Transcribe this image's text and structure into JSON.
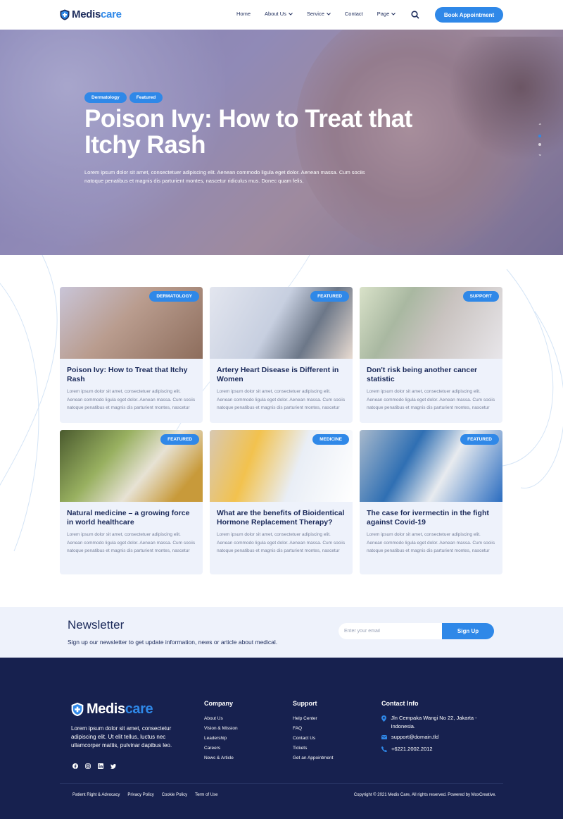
{
  "header": {
    "brand_part1": "Medis",
    "brand_part2": "care",
    "nav": [
      {
        "label": "Home",
        "dropdown": false
      },
      {
        "label": "About Us",
        "dropdown": true
      },
      {
        "label": "Service",
        "dropdown": true
      },
      {
        "label": "Contact",
        "dropdown": false
      },
      {
        "label": "Page",
        "dropdown": true
      }
    ],
    "cta": "Book Appointment"
  },
  "hero": {
    "tags": [
      "Dermatology",
      "Featured"
    ],
    "title": "Poison Ivy: How to Treat that Itchy Rash",
    "text": "Lorem ipsum dolor sit amet, consectetuer adipiscing elit. Aenean commodo ligula eget dolor. Aenean massa. Cum sociis natoque penatibus et magnis dis parturient montes, nascetur ridiculus mus. Donec quam felis,"
  },
  "articles": [
    {
      "badge": "DERMATOLOGY",
      "title": "Poison Ivy: How to Treat that Itchy Rash",
      "desc": "Lorem ipsum dolor sit amet, consectetuer adipiscing elit. Aenean commodo ligula eget dolor. Aenean massa. Cum sociis natoque penatibus et magnis dis parturient montes, nascetur"
    },
    {
      "badge": "FEATURED",
      "title": "Artery Heart Disease is Different in Women",
      "desc": "Lorem ipsum dolor sit amet, consectetuer adipiscing elit. Aenean commodo ligula eget dolor. Aenean massa. Cum sociis natoque penatibus et magnis dis parturient montes, nascetur"
    },
    {
      "badge": "SUPPORT",
      "title": "Don't risk being another cancer statistic",
      "desc": "Lorem ipsum dolor sit amet, consectetuer adipiscing elit. Aenean commodo ligula eget dolor. Aenean massa. Cum sociis natoque penatibus et magnis dis parturient montes, nascetur"
    },
    {
      "badge": "FEATURED",
      "title": "Natural medicine – a growing force in world healthcare",
      "desc": "Lorem ipsum dolor sit amet, consectetuer adipiscing elit. Aenean commodo ligula eget dolor. Aenean massa. Cum sociis natoque penatibus et magnis dis parturient montes, nascetur"
    },
    {
      "badge": "MEDICINE",
      "title": "What are the benefits of Bioidentical Hormone Replacement Therapy?",
      "desc": "Lorem ipsum dolor sit amet, consectetuer adipiscing elit. Aenean commodo ligula eget dolor. Aenean massa. Cum sociis natoque penatibus et magnis dis parturient montes, nascetur"
    },
    {
      "badge": "FEATURED",
      "title": "The case for ivermectin in the fight against Covid-19",
      "desc": "Lorem ipsum dolor sit amet, consectetuer adipiscing elit. Aenean commodo ligula eget dolor. Aenean massa. Cum sociis natoque penatibus et magnis dis parturient montes, nascetur"
    }
  ],
  "newsletter": {
    "title": "Newsletter",
    "subtitle": "Sign up our newsletter to get update information, news or article about medical.",
    "placeholder": "Enter your email",
    "button": "Sign Up"
  },
  "footer": {
    "brand_part1": "Medis",
    "brand_part2": "care",
    "about": "Lorem ipsum dolor sit amet, consectetur adipiscing elit. Ut elit tellus, luctus nec ullamcorper mattis, pulvinar dapibus leo.",
    "company_title": "Company",
    "company_links": [
      "About Us",
      "Vision & Mission",
      "Leadership",
      "Careers",
      "News & Article"
    ],
    "support_title": "Support",
    "support_links": [
      "Help Center",
      "FAQ",
      "Contact Us",
      "Tickets",
      "Get an Appointment"
    ],
    "contact_title": "Contact Info",
    "address": "Jln Cempaka Wangi No 22, Jakarta - Indonesia.",
    "email": "support@domain.tld",
    "phone": "+6221.2002.2012",
    "bottom_links": [
      "Patient Right & Advocacy",
      "Privacy Policy",
      "Cookie Policy",
      "Term of Use"
    ],
    "copyright": "Copyright © 2021 Medis Care, All rights reserved. Powered by MoxCreative."
  },
  "colors": {
    "accent": "#2f88e8",
    "navy": "#1b2a5a",
    "footer_bg": "#17214f",
    "card_bg": "#eef2fb"
  },
  "icons": {
    "search": "search-icon",
    "logo": "shield-plus-icon",
    "socials": [
      "facebook-icon",
      "instagram-icon",
      "linkedin-icon",
      "twitter-icon"
    ]
  }
}
